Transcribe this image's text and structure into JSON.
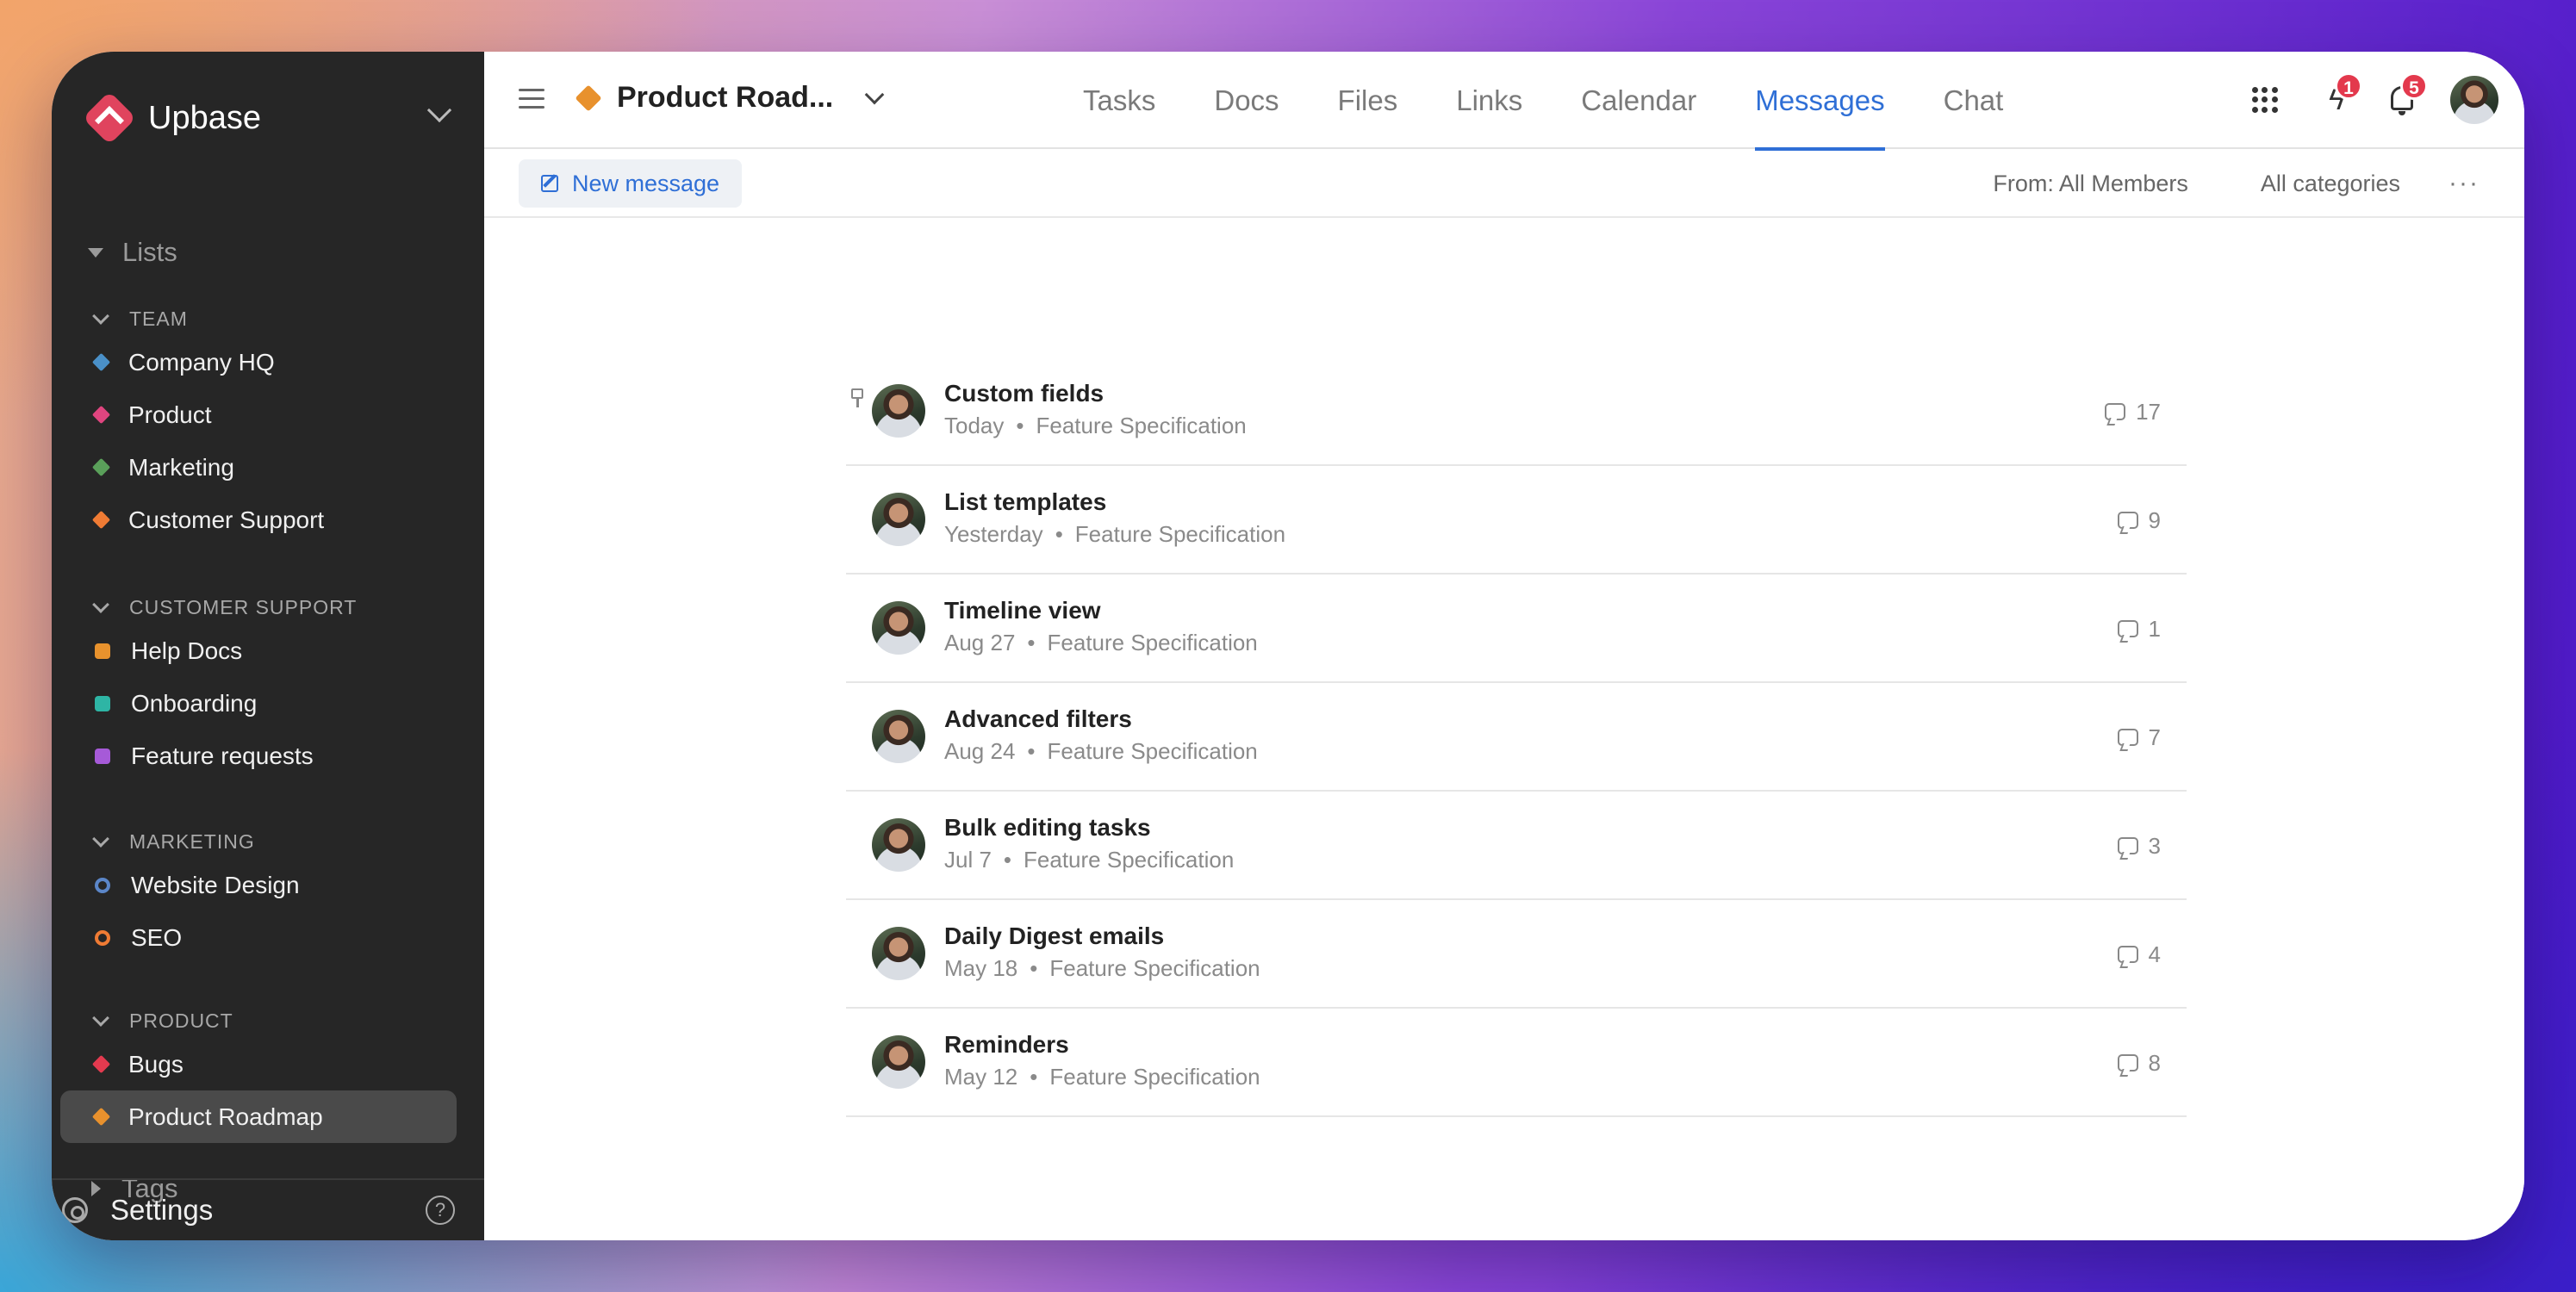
{
  "app": {
    "name": "Upbase"
  },
  "sidebar": {
    "lists_label": "Lists",
    "sections": [
      {
        "title": "TEAM",
        "items": [
          {
            "label": "Company HQ",
            "color": "#4a90c8",
            "shape": "diamond"
          },
          {
            "label": "Product",
            "color": "#e0457f",
            "shape": "diamond"
          },
          {
            "label": "Marketing",
            "color": "#5aa05a",
            "shape": "diamond"
          },
          {
            "label": "Customer Support",
            "color": "#ef7b34",
            "shape": "diamond"
          }
        ]
      },
      {
        "title": "CUSTOMER SUPPORT",
        "items": [
          {
            "label": "Help Docs",
            "color": "#e8922d",
            "shape": "square"
          },
          {
            "label": "Onboarding",
            "color": "#2eb5a5",
            "shape": "square"
          },
          {
            "label": "Feature requests",
            "color": "#a65ad8",
            "shape": "square"
          }
        ]
      },
      {
        "title": "MARKETING",
        "items": [
          {
            "label": "Website Design",
            "color": "#5b86c8",
            "shape": "ring"
          },
          {
            "label": "SEO",
            "color": "#ef7b34",
            "shape": "ring"
          }
        ]
      },
      {
        "title": "PRODUCT",
        "items": [
          {
            "label": "Bugs",
            "color": "#e33a4f",
            "shape": "diamond"
          },
          {
            "label": "Product Roadmap",
            "color": "#e8912d",
            "shape": "diamond",
            "active": true
          }
        ]
      }
    ],
    "tags_label": "Tags",
    "settings_label": "Settings",
    "help_glyph": "?"
  },
  "header": {
    "project_title": "Product Road...",
    "project_color": "#e8912d",
    "tabs": [
      "Tasks",
      "Docs",
      "Files",
      "Links",
      "Calendar",
      "Messages",
      "Chat"
    ],
    "active_tab": "Messages",
    "activity_badge": "1",
    "notification_badge": "5"
  },
  "toolbar": {
    "new_message_label": "New message",
    "from_filter": "From:  All Members",
    "category_filter": "All categories",
    "more_glyph": "···"
  },
  "messages": [
    {
      "title": "Custom fields",
      "date": "Today",
      "category": "Feature Specification",
      "comments": "17",
      "pinned": true
    },
    {
      "title": "List templates",
      "date": "Yesterday",
      "category": "Feature Specification",
      "comments": "9"
    },
    {
      "title": "Timeline view",
      "date": "Aug 27",
      "category": "Feature Specification",
      "comments": "1"
    },
    {
      "title": "Advanced filters",
      "date": "Aug 24",
      "category": "Feature Specification",
      "comments": "7"
    },
    {
      "title": "Bulk editing tasks",
      "date": "Jul 7",
      "category": "Feature Specification",
      "comments": "3"
    },
    {
      "title": "Daily Digest emails",
      "date": "May 18",
      "category": "Feature Specification",
      "comments": "4"
    },
    {
      "title": "Reminders",
      "date": "May 12",
      "category": "Feature Specification",
      "comments": "8"
    }
  ],
  "meta_separator": "•"
}
